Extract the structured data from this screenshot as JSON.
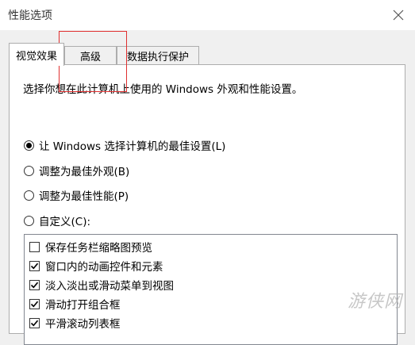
{
  "window": {
    "title": "性能选项",
    "close_icon": "close-icon"
  },
  "tabs": [
    {
      "label": "视觉效果",
      "active": true
    },
    {
      "label": "高级",
      "active": false
    },
    {
      "label": "数据执行保护",
      "active": false
    }
  ],
  "description": "选择你想在此计算机上使用的 Windows 外观和性能设置。",
  "radio_options": [
    {
      "label": "让 Windows 选择计算机的最佳设置(L)",
      "checked": true
    },
    {
      "label": "调整为最佳外观(B)",
      "checked": false
    },
    {
      "label": "调整为最佳性能(P)",
      "checked": false
    },
    {
      "label": "自定义(C):",
      "checked": false
    }
  ],
  "effects": [
    {
      "label": "保存任务栏缩略图预览",
      "checked": false
    },
    {
      "label": "窗口内的动画控件和元素",
      "checked": true
    },
    {
      "label": "淡入淡出或滑动菜单到视图",
      "checked": true
    },
    {
      "label": "滑动打开组合框",
      "checked": true
    },
    {
      "label": "平滑滚动列表框",
      "checked": true
    }
  ],
  "watermark": "游侠网",
  "colors": {
    "highlight": "#e03030",
    "border": "#adadad"
  }
}
